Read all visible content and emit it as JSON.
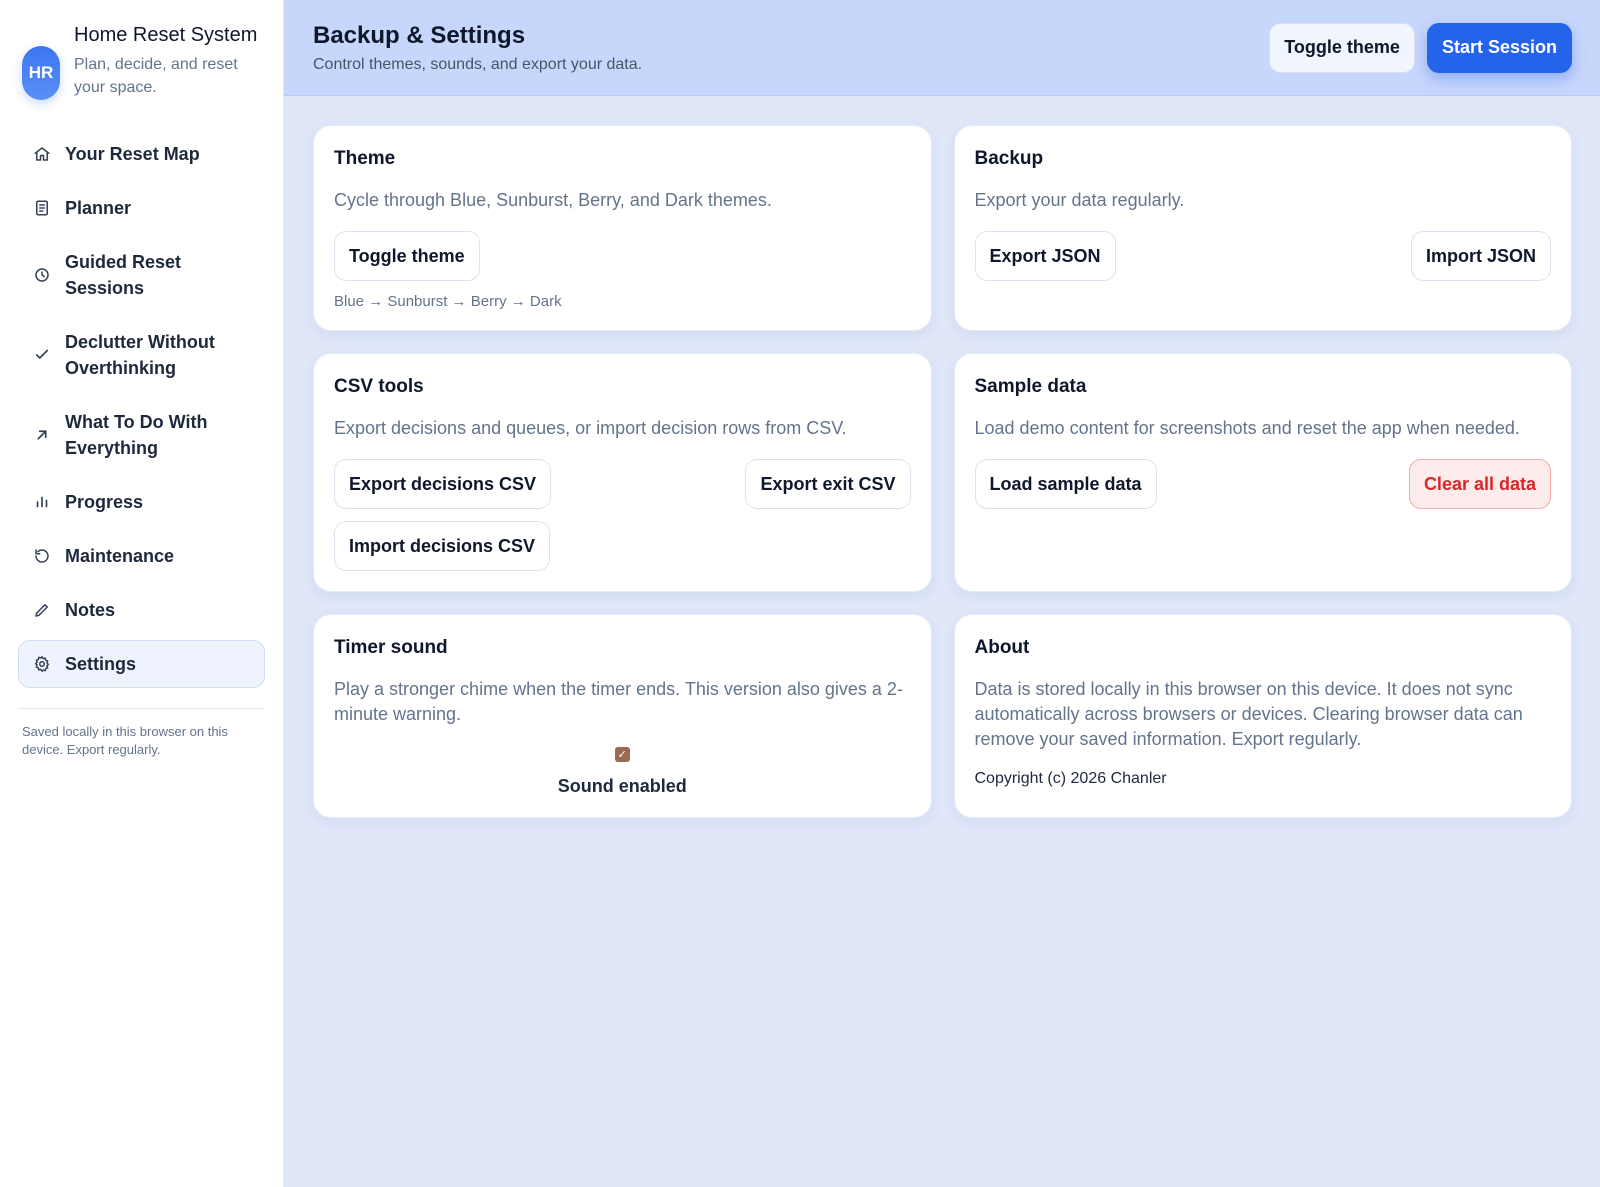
{
  "brand": {
    "initials": "HR",
    "title": "Home Reset System",
    "subtitle": "Plan, decide, and reset your space."
  },
  "sidebar": {
    "items": [
      {
        "label": "Your Reset Map",
        "icon": "home-icon"
      },
      {
        "label": "Planner",
        "icon": "document-icon"
      },
      {
        "label": "Guided Reset Sessions",
        "icon": "clock-icon"
      },
      {
        "label": "Declutter Without Overthinking",
        "icon": "check-icon"
      },
      {
        "label": "What To Do With Everything",
        "icon": "arrow-up-right-icon"
      },
      {
        "label": "Progress",
        "icon": "bar-chart-icon"
      },
      {
        "label": "Maintenance",
        "icon": "refresh-icon"
      },
      {
        "label": "Notes",
        "icon": "pencil-icon"
      },
      {
        "label": "Settings",
        "icon": "gear-icon",
        "active": true
      }
    ],
    "footer_note": "Saved locally in this browser on this device. Export regularly."
  },
  "header": {
    "title": "Backup & Settings",
    "subtitle": "Control themes, sounds, and export your data.",
    "toggle_theme_label": "Toggle theme",
    "start_session_label": "Start Session"
  },
  "cards": {
    "theme": {
      "title": "Theme",
      "description": "Cycle through Blue, Sunburst, Berry, and Dark themes.",
      "button": "Toggle theme",
      "hint": "Blue → Sunburst → Berry → Dark"
    },
    "backup": {
      "title": "Backup",
      "description": "Export your data regularly.",
      "export_button": "Export JSON",
      "import_button": "Import JSON"
    },
    "csv": {
      "title": "CSV tools",
      "description": "Export decisions and queues, or import decision rows from CSV.",
      "export_decisions": "Export decisions CSV",
      "export_exit": "Export exit CSV",
      "import_decisions": "Import decisions CSV"
    },
    "sample": {
      "title": "Sample data",
      "description": "Load demo content for screenshots and reset the app when needed.",
      "load_button": "Load sample data",
      "clear_button": "Clear all data"
    },
    "timer": {
      "title": "Timer sound",
      "description": "Play a stronger chime when the timer ends. This version also gives a 2-minute warning.",
      "checkbox_checked": true,
      "checkbox_label": "Sound enabled"
    },
    "about": {
      "title": "About",
      "description": "Data is stored locally in this browser on this device. It does not sync automatically across browsers or devices. Clearing browser data can remove your saved information. Export regularly.",
      "copyright": "Copyright (c) 2026 Chanler"
    }
  },
  "colors": {
    "accent": "#2563eb",
    "header_bg": "#c7d6fb",
    "page_bg": "#dfe7f8",
    "danger": "#dc2626",
    "checkbox": "#9a6a52"
  }
}
